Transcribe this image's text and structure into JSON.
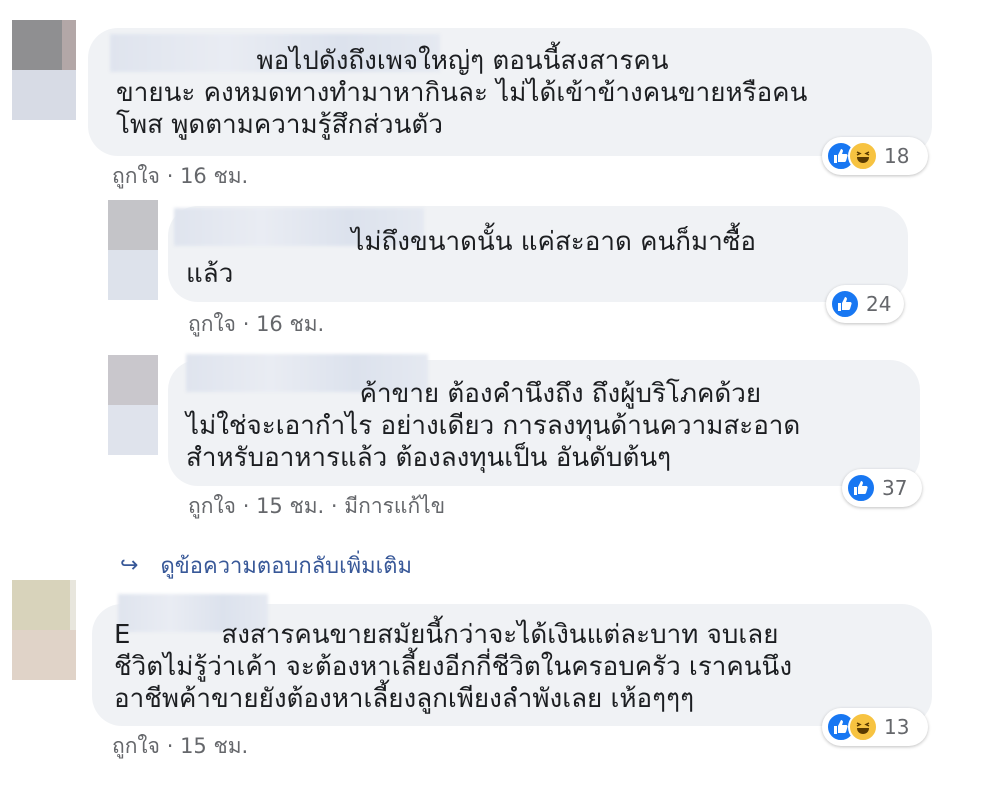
{
  "comments": [
    {
      "text": "                 พอไปดังถึงเพจใหญ่ๆ ตอนนี้สงสารคน\nขายนะ คงหมดทางทำมาหากินละ ไม่ได้เข้าข้างคนขายหรือคน\nโพส พูดตามความรู้สึกส่วนตัว",
      "like_label": "ถูกใจ",
      "separator": "·",
      "time": "16 ชม.",
      "reaction_count": "18",
      "reactions": [
        "like-icon",
        "haha-icon"
      ]
    },
    {
      "text": "                    ไม่ถึงขนาดนั้น แค่สะอาด คนก็มาซื้อ\nแล้ว",
      "like_label": "ถูกใจ",
      "separator": "·",
      "time": "16 ชม.",
      "reaction_count": "24",
      "reactions": [
        "like-icon"
      ]
    },
    {
      "text": "                     ค้าขาย ต้องคำนึงถึง ถึงผู้บริโภคด้วย\nไม่ใช่จะเอากำไร อย่างเดียว การลงทุนด้านความสะอาด\nสำหรับอาหารแล้ว ต้องลงทุนเป็น อันดับต้นๆ",
      "like_label": "ถูกใจ",
      "separator": "·",
      "time": "15 ชม.",
      "edited": "มีการแก้ไข",
      "reaction_count": "37",
      "reactions": [
        "like-icon"
      ]
    },
    {
      "text": "E           สงสารคนขายสมัยนี้กว่าจะได้เงินแต่ละบาท จบเลย\nชีวิตไม่รู้ว่าเค้า จะต้องหาเลี้ยงอีกกี่ชีวิตในครอบครัว เราคนนึง\nอาชีพค้าขายยังต้องหาเลี้ยงลูกเพียงลำพังเลย เห้อๆๆๆ",
      "like_label": "ถูกใจ",
      "separator": "·",
      "time": "15 ชม.",
      "reaction_count": "13",
      "reactions": [
        "like-icon",
        "haha-icon"
      ]
    }
  ],
  "more_replies": "ดูข้อความตอบกลับเพิ่มเติม",
  "colors": {
    "bubble": "#f0f2f5",
    "meta_text": "#65676b",
    "link": "#385898",
    "like": "#1877f2",
    "haha": "#f7c341"
  }
}
